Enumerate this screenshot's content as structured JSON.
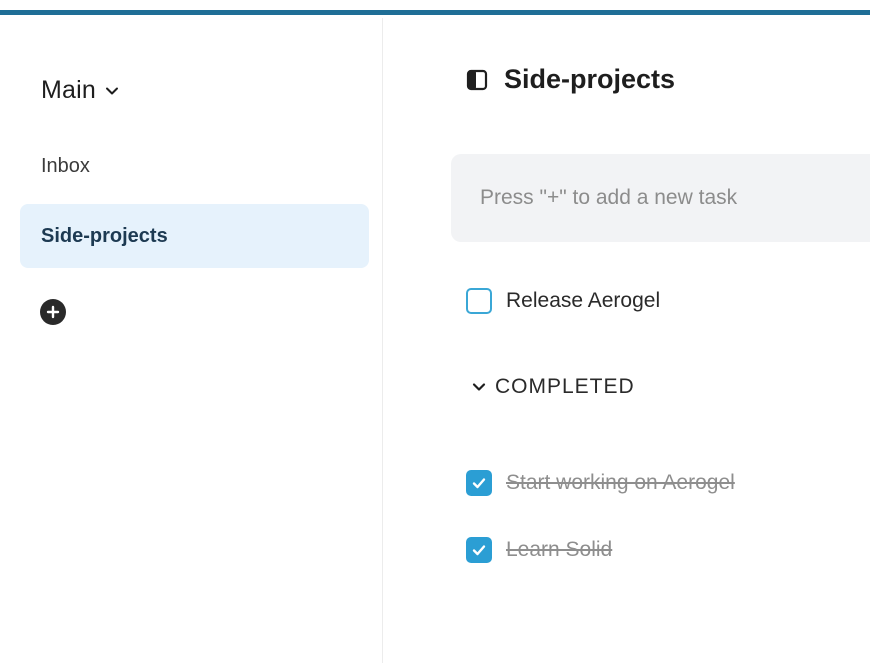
{
  "sidebar": {
    "workspace": "Main",
    "items": [
      {
        "label": "Inbox"
      },
      {
        "label": "Side-projects"
      }
    ]
  },
  "main": {
    "title": "Side-projects",
    "task_input": {
      "placeholder": "Press \"+\" to add a new task",
      "value": ""
    },
    "open_tasks": [
      {
        "label": "Release Aerogel",
        "done": false
      }
    ],
    "completed_section": {
      "label": "COMPLETED",
      "tasks": [
        {
          "label": "Start working on Aerogel",
          "done": true
        },
        {
          "label": "Learn Solid",
          "done": true
        }
      ]
    }
  },
  "colors": {
    "accent_bar": "#1f6e96",
    "active_item_bg": "#e6f2fc",
    "checkbox_checked": "#2b9ed4",
    "checkbox_border": "#3aa7d6"
  },
  "icons": {
    "workspace_chevron": "chevron-down-icon",
    "add_list": "plus-circle-icon",
    "list_type": "panel-icon",
    "section_chevron": "chevron-down-icon",
    "check": "check-icon"
  }
}
